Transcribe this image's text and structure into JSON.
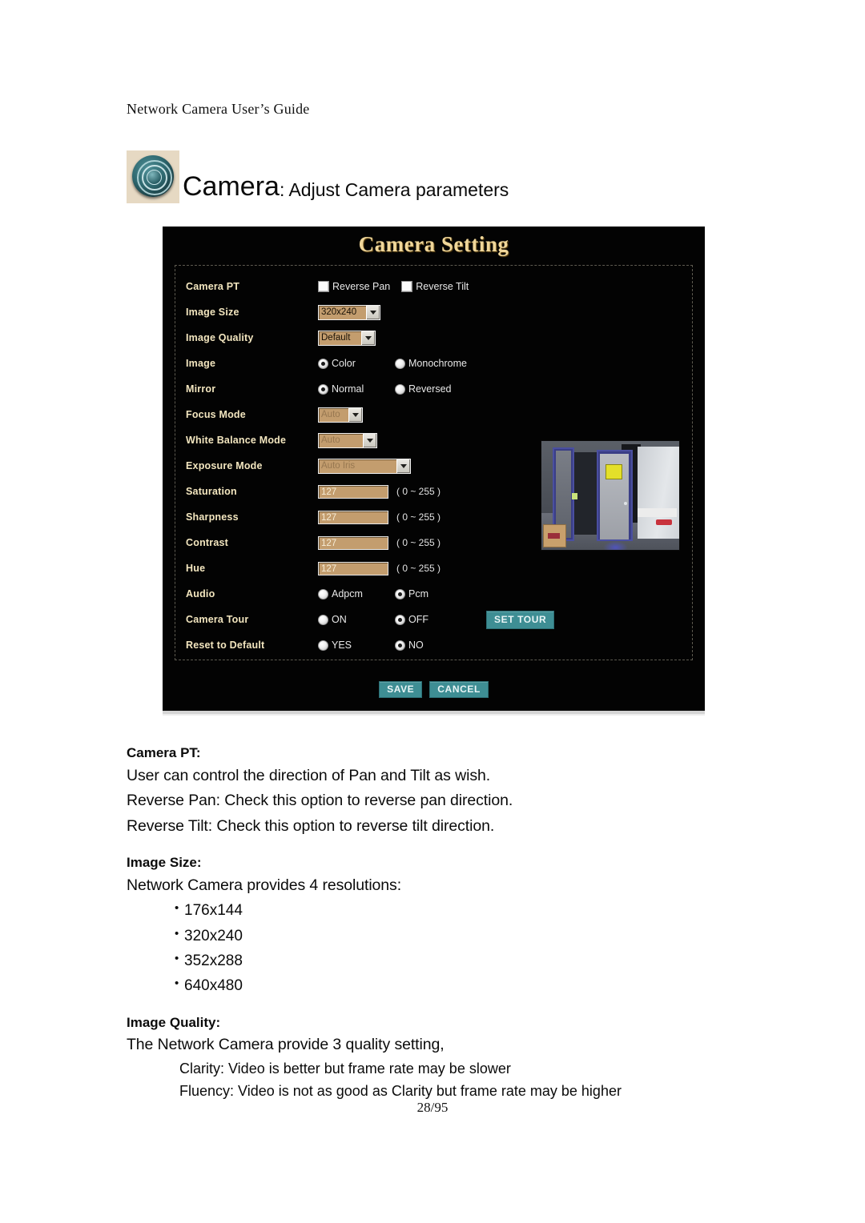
{
  "document": {
    "running_header": "Network Camera User’s Guide",
    "page_number": "28/95"
  },
  "section": {
    "icon": "camera-lens-icon",
    "title_main": "Camera",
    "title_sub": ": Adjust Camera parameters"
  },
  "panel": {
    "title": "Camera Setting",
    "rows": {
      "camera_pt": {
        "label": "Camera PT",
        "reverse_pan_label": "Reverse Pan",
        "reverse_pan_checked": false,
        "reverse_tilt_label": "Reverse Tilt",
        "reverse_tilt_checked": false
      },
      "image_size": {
        "label": "Image Size",
        "value": "320x240",
        "options": [
          "176x144",
          "320x240",
          "352x288",
          "640x480"
        ]
      },
      "image_quality": {
        "label": "Image Quality",
        "value": "Default",
        "options": [
          "Default",
          "Clarity",
          "Fluency"
        ]
      },
      "image": {
        "label": "Image",
        "option_a": "Color",
        "option_b": "Monochrome",
        "selected": "Color"
      },
      "mirror": {
        "label": "Mirror",
        "option_a": "Normal",
        "option_b": "Reversed",
        "selected": "Normal"
      },
      "focus_mode": {
        "label": "Focus Mode",
        "value": "Auto",
        "disabled": true
      },
      "white_balance_mode": {
        "label": "White Balance Mode",
        "value": "Auto",
        "disabled": true
      },
      "exposure_mode": {
        "label": "Exposure Mode",
        "value": "Auto Iris",
        "disabled": true
      },
      "saturation": {
        "label": "Saturation",
        "value": "127",
        "range_hint": "( 0 ~ 255 )"
      },
      "sharpness": {
        "label": "Sharpness",
        "value": "127",
        "range_hint": "( 0 ~ 255 )"
      },
      "contrast": {
        "label": "Contrast",
        "value": "127",
        "range_hint": "( 0 ~ 255 )"
      },
      "hue": {
        "label": "Hue",
        "value": "127",
        "range_hint": "( 0 ~ 255 )"
      },
      "audio": {
        "label": "Audio",
        "option_a": "Adpcm",
        "option_b": "Pcm",
        "selected": "Pcm"
      },
      "camera_tour": {
        "label": "Camera Tour",
        "option_a": "ON",
        "option_b": "OFF",
        "selected": "OFF",
        "set_tour_label": "SET TOUR"
      },
      "reset_to_default": {
        "label": "Reset to Default",
        "option_a": "YES",
        "option_b": "NO",
        "selected": "NO"
      }
    },
    "preview": {
      "name": "live-video-preview"
    },
    "buttons": {
      "save": "SAVE",
      "cancel": "CANCEL"
    },
    "colors": {
      "panel_bg": "#030303",
      "title_gold": "#f0d79a",
      "label_gold": "#f3e6bf",
      "field_tan": "#c39d6e",
      "button_teal": "#3e8e94"
    }
  },
  "body": {
    "camera_pt": {
      "heading": "Camera PT:",
      "lines": [
        "User can control the direction of Pan and Tilt as wish.",
        "Reverse Pan: Check this option to reverse pan direction.",
        "Reverse Tilt: Check this option to reverse tilt direction."
      ]
    },
    "image_size": {
      "heading": "Image Size:",
      "intro": "Network Camera provides 4 resolutions:",
      "bullets": [
        "176x144",
        "320x240",
        "352x288",
        "640x480"
      ]
    },
    "image_quality": {
      "heading": "Image Quality:",
      "intro": "The Network Camera provide 3 quality setting,",
      "lines": [
        "Clarity: Video is better but frame rate may be slower",
        "Fluency: Video is not as good as Clarity but frame rate may be higher"
      ]
    }
  }
}
